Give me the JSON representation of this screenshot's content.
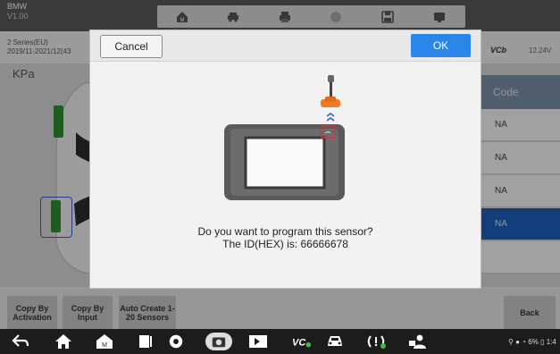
{
  "header": {
    "brand": "BMW",
    "version": "V1.00"
  },
  "toolbar": {
    "icons": [
      "home-icon",
      "vehicle-icon",
      "print-icon",
      "help-icon",
      "save-icon",
      "data-logging-icon"
    ]
  },
  "vehicle": {
    "model": "2 Series(EU)",
    "dates": "2019/11-2021/12(43",
    "vci_label": "VCb",
    "voltage": "12.24V"
  },
  "left_panel": {
    "unit": "KPa"
  },
  "right_panel": {
    "header": "Code",
    "rows": [
      "NA",
      "NA",
      "NA",
      "NA",
      ""
    ]
  },
  "bottom_buttons": {
    "copy_activation": "Copy By Activation",
    "copy_input": "Copy By Input",
    "auto_create": "Auto Create 1-20 Sensors",
    "back": "Back"
  },
  "dialog": {
    "cancel": "Cancel",
    "ok": "OK",
    "line1": "Do you want to program this sensor?",
    "line2": "The ID(HEX) is: 66666678"
  },
  "statusbar": {
    "battery": "6%",
    "time": "1:4"
  },
  "colors": {
    "accent_blue": "#2a86e8",
    "selected_row": "#1f5fbf",
    "tire_green": "#2f8f35"
  }
}
